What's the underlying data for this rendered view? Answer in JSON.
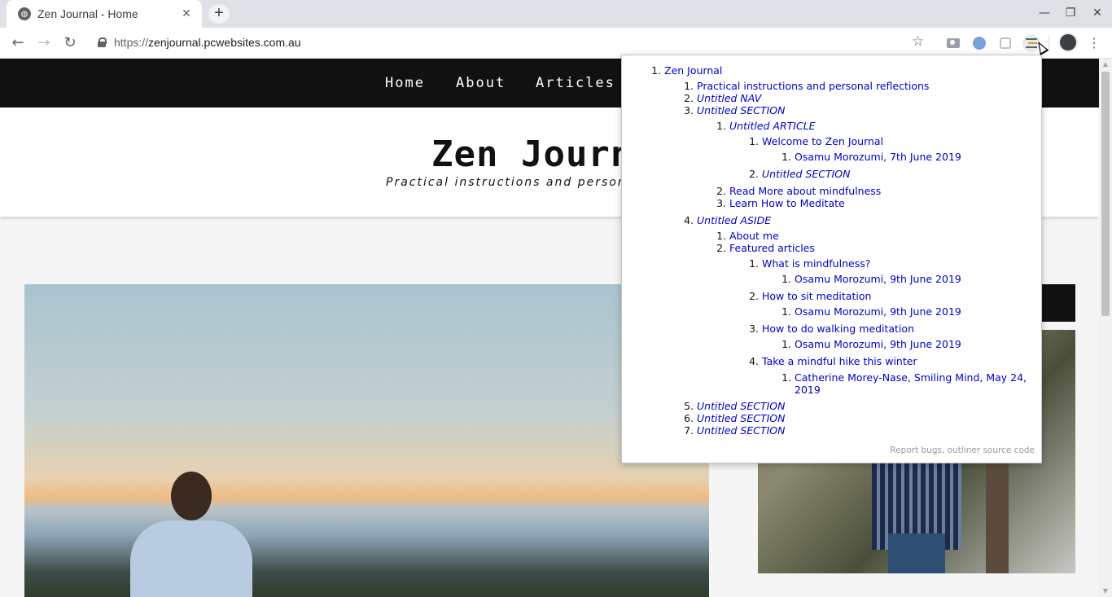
{
  "browser": {
    "tab_title": "Zen Journal - Home",
    "tab_close": "✕",
    "new_tab": "+",
    "url_scheme": "https://",
    "url_host": "zenjournal.pcwebsites.com.au",
    "minimize": "—",
    "restore": "❐",
    "close": "✕",
    "back": "←",
    "forward": "→",
    "reload": "↻",
    "star": "☆",
    "menu": "⋮"
  },
  "site": {
    "nav": [
      "Home",
      "About",
      "Articles"
    ],
    "title": "Zen Journal",
    "tagline": "Practical instructions and personal reflections"
  },
  "outline": {
    "rows": [
      {
        "n": "1.",
        "text": "Zen Journal",
        "untitled": false
      },
      {
        "n": "1.",
        "text": "Practical instructions and personal reflections",
        "untitled": false
      },
      {
        "n": "2.",
        "text": "Untitled NAV",
        "untitled": true
      },
      {
        "n": "3.",
        "text": "Untitled SECTION",
        "untitled": true
      },
      {
        "n": "1.",
        "text": "Untitled ARTICLE",
        "untitled": true
      },
      {
        "n": "1.",
        "text": "Welcome to Zen Journal",
        "untitled": false
      },
      {
        "n": "1.",
        "text": "Osamu Morozumi, 7th June 2019",
        "untitled": false
      },
      {
        "n": "2.",
        "text": "Untitled SECTION",
        "untitled": true
      },
      {
        "n": "2.",
        "text": "Read More about mindfulness",
        "untitled": false
      },
      {
        "n": "3.",
        "text": "Learn How to Meditate",
        "untitled": false
      },
      {
        "n": "4.",
        "text": "Untitled ASIDE",
        "untitled": true
      },
      {
        "n": "1.",
        "text": "About me",
        "untitled": false
      },
      {
        "n": "2.",
        "text": "Featured articles",
        "untitled": false
      },
      {
        "n": "1.",
        "text": "What is mindfulness?",
        "untitled": false
      },
      {
        "n": "1.",
        "text": "Osamu Morozumi, 9th June 2019",
        "untitled": false
      },
      {
        "n": "2.",
        "text": "How to sit meditation",
        "untitled": false
      },
      {
        "n": "1.",
        "text": "Osamu Morozumi, 9th June 2019",
        "untitled": false
      },
      {
        "n": "3.",
        "text": "How to do walking meditation",
        "untitled": false
      },
      {
        "n": "1.",
        "text": "Osamu Morozumi, 9th June 2019",
        "untitled": false
      },
      {
        "n": "4.",
        "text": "Take a mindful hike this winter",
        "untitled": false
      },
      {
        "n": "1.",
        "text": "Catherine Morey-Nase, Smiling Mind, May 24,",
        "untitled": false
      },
      {
        "n": "",
        "text": "2019",
        "untitled": false
      },
      {
        "n": "5.",
        "text": "Untitled SECTION",
        "untitled": true
      },
      {
        "n": "6.",
        "text": "Untitled SECTION",
        "untitled": true
      },
      {
        "n": "7.",
        "text": "Untitled SECTION",
        "untitled": true
      }
    ],
    "footer_report": "Report bugs",
    "footer_sep": ", ",
    "footer_source": "outliner source code"
  },
  "icons": {
    "favicon": "globe-icon",
    "extensions": [
      "camera-icon",
      "circle-extension-icon",
      "grid-extension-icon",
      "outliner-icon"
    ]
  }
}
